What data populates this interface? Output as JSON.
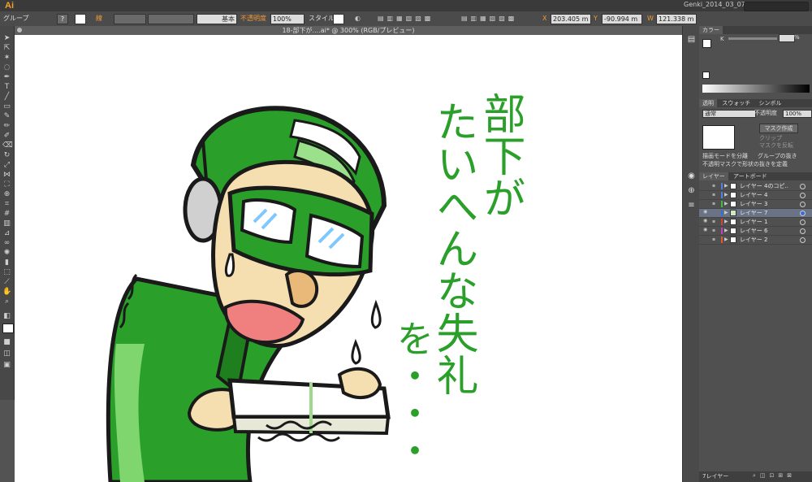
{
  "app": {
    "logo": "Ai",
    "workspace": "Genki_2014_03_07"
  },
  "controlbar": {
    "selection_type": "グループ",
    "help_icon": "?",
    "stroke_label": "線",
    "stroke_profile": "基本",
    "opacity_label": "不透明度",
    "opacity_value": "100%",
    "style_label": "スタイル",
    "x_label": "X",
    "x_value": "203.405 m",
    "y_label": "Y",
    "y_value": "-90.994 m",
    "w_label": "W",
    "w_value": "121.338 m"
  },
  "document": {
    "tab_title": "18-部下が....ai* @ 300% (RGB/プレビュー)"
  },
  "artwork": {
    "caption_columns": [
      "部下が",
      "たいへんな失礼",
      "を・・・"
    ],
    "colors": {
      "green": "#2aa02a",
      "skin": "#f5deb0",
      "outline": "#1a1a1a",
      "selection": "#39e5ee"
    }
  },
  "panels": {
    "color": {
      "title": "カラー",
      "k_label": "K",
      "k_value": "%"
    },
    "transparency": {
      "tabs": [
        "透明",
        "スウォッチ",
        "シンボル"
      ],
      "blend_mode": "通常",
      "opacity_label": "不透明度",
      "opacity_value": "100%",
      "make_mask": "マスク作成",
      "clip": "クリップ",
      "invert_mask": "マスクを反転",
      "isolate_blending": "描画モードを分離",
      "knockout_group": "グループの抜き",
      "opacity_mask_define": "不透明マスクで形状の抜きを定義"
    },
    "layers": {
      "tabs": [
        "レイヤー",
        "アートボード"
      ],
      "items": [
        {
          "name": "レイヤー 4のコピ..",
          "color": "#4f7fe0",
          "visible": false,
          "selected": false
        },
        {
          "name": "レイヤー 4",
          "color": "#4f7fe0",
          "visible": false,
          "selected": false
        },
        {
          "name": "レイヤー 3",
          "color": "#3bbf3b",
          "visible": false,
          "selected": false
        },
        {
          "name": "レイヤー 7",
          "color": "#3c6bd8",
          "visible": true,
          "selected": true
        },
        {
          "name": "レイヤー 1",
          "color": "#d04040",
          "visible": true,
          "selected": false
        },
        {
          "name": "レイヤー 6",
          "color": "#c040c0",
          "visible": true,
          "selected": false
        },
        {
          "name": "レイヤー 2",
          "color": "#e05a2a",
          "visible": false,
          "selected": false
        }
      ],
      "footer_count": "7レイヤー"
    }
  }
}
